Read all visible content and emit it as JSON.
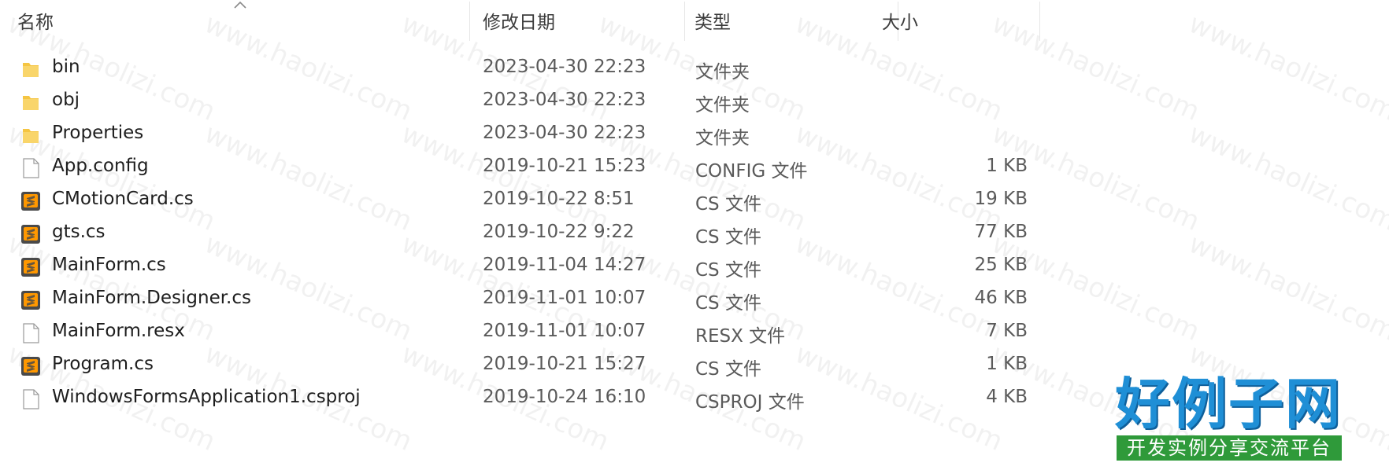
{
  "columns": {
    "name": "名称",
    "date": "修改日期",
    "type": "类型",
    "size": "大小"
  },
  "files": [
    {
      "name": "bin",
      "date": "2023-04-30 22:23",
      "type": "文件夹",
      "size": "",
      "icon": "folder-icon"
    },
    {
      "name": "obj",
      "date": "2023-04-30 22:23",
      "type": "文件夹",
      "size": "",
      "icon": "folder-icon"
    },
    {
      "name": "Properties",
      "date": "2023-04-30 22:23",
      "type": "文件夹",
      "size": "",
      "icon": "folder-icon"
    },
    {
      "name": "App.config",
      "date": "2019-10-21 15:23",
      "type": "CONFIG 文件",
      "size": "1 KB",
      "icon": "blank-file-icon"
    },
    {
      "name": "CMotionCard.cs",
      "date": "2019-10-22 8:51",
      "type": "CS 文件",
      "size": "19 KB",
      "icon": "sublime-cs-file-icon"
    },
    {
      "name": "gts.cs",
      "date": "2019-10-22 9:22",
      "type": "CS 文件",
      "size": "77 KB",
      "icon": "sublime-cs-file-icon"
    },
    {
      "name": "MainForm.cs",
      "date": "2019-11-04 14:27",
      "type": "CS 文件",
      "size": "25 KB",
      "icon": "sublime-cs-file-icon"
    },
    {
      "name": "MainForm.Designer.cs",
      "date": "2019-11-01 10:07",
      "type": "CS 文件",
      "size": "46 KB",
      "icon": "sublime-cs-file-icon"
    },
    {
      "name": "MainForm.resx",
      "date": "2019-11-01 10:07",
      "type": "RESX 文件",
      "size": "7 KB",
      "icon": "blank-file-icon"
    },
    {
      "name": "Program.cs",
      "date": "2019-10-21 15:27",
      "type": "CS 文件",
      "size": "1 KB",
      "icon": "sublime-cs-file-icon"
    },
    {
      "name": "WindowsFormsApplication1.csproj",
      "date": "2019-10-24 16:10",
      "type": "CSPROJ 文件",
      "size": "4 KB",
      "icon": "blank-file-icon"
    }
  ],
  "watermark": "www.haolizi.com",
  "brand": {
    "title": "好例子网",
    "slogan": "开发实例分享交流平台"
  },
  "colors": {
    "folder": "#f5c542",
    "sublime_icon": "#ff9800",
    "brand_blue": "#1f8fd6",
    "brand_green": "#2f9a3a"
  }
}
